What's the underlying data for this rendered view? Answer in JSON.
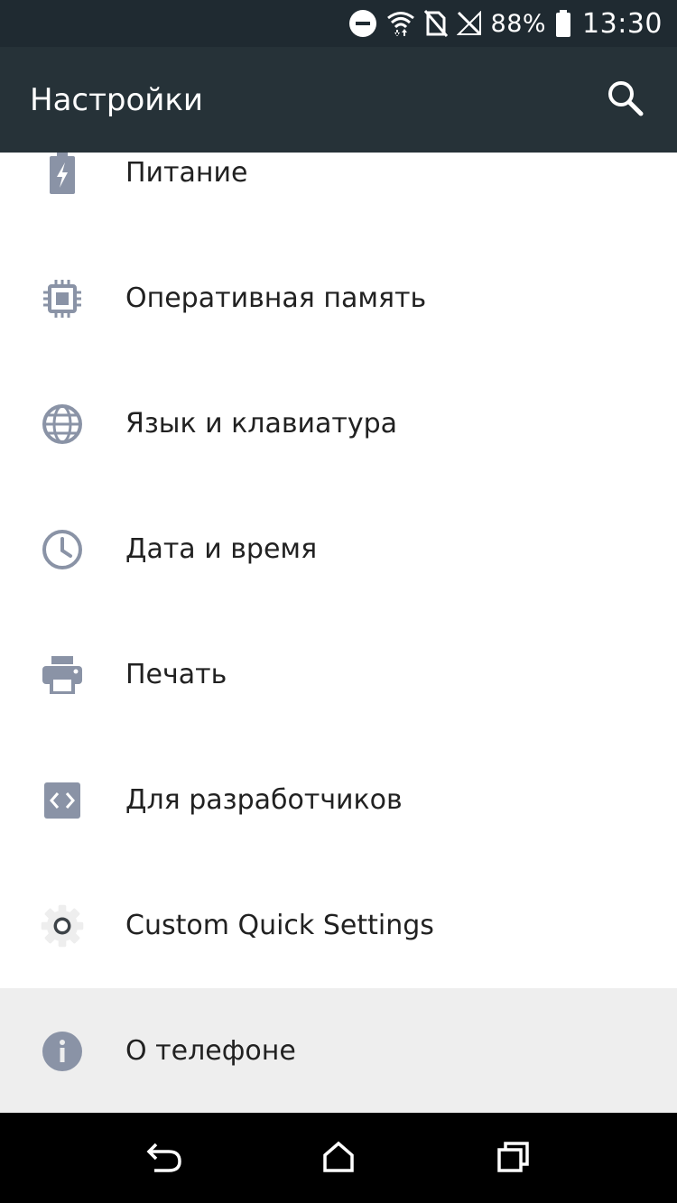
{
  "status_bar": {
    "battery_percent": "88%",
    "time": "13:30",
    "icons": [
      "do-not-disturb-icon",
      "wifi-icon",
      "no-sim-icon",
      "signal-off-icon",
      "battery-icon"
    ]
  },
  "app_bar": {
    "title": "Настройки",
    "search_icon": "search-icon"
  },
  "settings": {
    "items": [
      {
        "label": "Питание",
        "icon": "battery-charging-icon"
      },
      {
        "label": "Оперативная память",
        "icon": "memory-chip-icon"
      },
      {
        "label": "Язык и клавиатура",
        "icon": "globe-icon"
      },
      {
        "label": "Дата и время",
        "icon": "clock-icon"
      },
      {
        "label": "Печать",
        "icon": "printer-icon"
      },
      {
        "label": "Для разработчиков",
        "icon": "developer-code-icon"
      },
      {
        "label": "Custom Quick Settings",
        "icon": "gear-icon"
      },
      {
        "label": "О телефоне",
        "icon": "info-icon"
      }
    ]
  },
  "nav_bar": {
    "icons": [
      "back-icon",
      "home-icon",
      "recents-icon"
    ]
  },
  "colors": {
    "status_bar_bg": "#1f2a31",
    "app_bar_bg": "#263238",
    "icon_gray": "#8a93a6",
    "highlight_bg": "#eeeeee",
    "text_primary": "#212121"
  }
}
